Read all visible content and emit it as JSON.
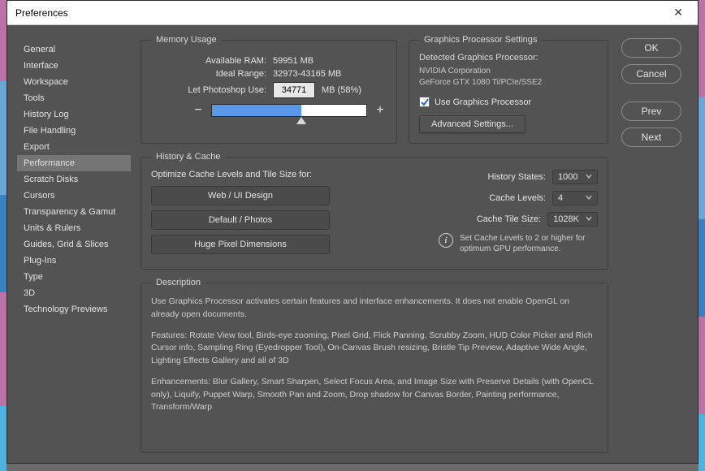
{
  "window": {
    "title": "Preferences"
  },
  "sidebar": {
    "items": [
      "General",
      "Interface",
      "Workspace",
      "Tools",
      "History Log",
      "File Handling",
      "Export",
      "Performance",
      "Scratch Disks",
      "Cursors",
      "Transparency & Gamut",
      "Units & Rulers",
      "Guides, Grid & Slices",
      "Plug-Ins",
      "Type",
      "3D",
      "Technology Previews"
    ],
    "selected_index": 7
  },
  "buttons": {
    "ok": "OK",
    "cancel": "Cancel",
    "prev": "Prev",
    "next": "Next"
  },
  "memory": {
    "legend": "Memory Usage",
    "available_label": "Available RAM:",
    "available_value": "59951 MB",
    "ideal_label": "Ideal Range:",
    "ideal_value": "32973-43165 MB",
    "use_label": "Let Photoshop Use:",
    "use_value": "34771",
    "use_unit": "MB (58%)",
    "minus": "−",
    "plus": "+"
  },
  "gpu": {
    "legend": "Graphics Processor Settings",
    "detected_label": "Detected Graphics Processor:",
    "vendor": "NVIDIA Corporation",
    "model": "GeForce GTX 1080 Ti/PCIe/SSE2",
    "checkbox_label": "Use Graphics Processor",
    "checkbox_checked": true,
    "advanced": "Advanced Settings..."
  },
  "history_cache": {
    "legend": "History & Cache",
    "optimize_label": "Optimize Cache Levels and Tile Size for:",
    "presets": [
      "Web / UI Design",
      "Default / Photos",
      "Huge Pixel Dimensions"
    ],
    "history_states_label": "History States:",
    "history_states_value": "1000",
    "cache_levels_label": "Cache Levels:",
    "cache_levels_value": "4",
    "cache_tile_label": "Cache Tile Size:",
    "cache_tile_value": "1028K",
    "hint": "Set Cache Levels to 2 or higher for optimum GPU performance."
  },
  "description": {
    "legend": "Description",
    "p1": "Use Graphics Processor activates certain features and interface enhancements. It does not enable OpenGL on already open documents.",
    "p2": "Features: Rotate View tool, Birds-eye zooming, Pixel Grid, Flick Panning, Scrubby Zoom, HUD Color Picker and Rich Cursor info, Sampling Ring (Eyedropper Tool), On-Canvas Brush resizing, Bristle Tip Preview, Adaptive Wide Angle, Lighting Effects Gallery and all of 3D",
    "p3": "Enhancements: Blur Gallery, Smart Sharpen, Select Focus Area, and Image Size with Preserve Details (with OpenCL only), Liquify, Puppet Warp, Smooth Pan and Zoom, Drop shadow for Canvas Border, Painting performance, Transform/Warp"
  }
}
